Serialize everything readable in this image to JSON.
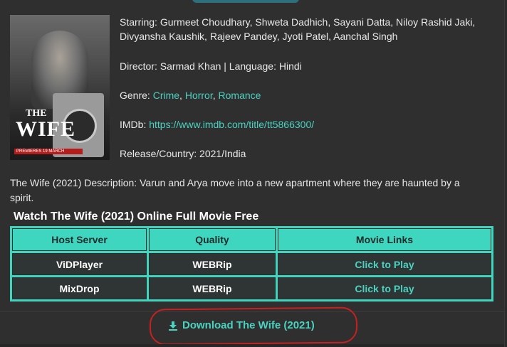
{
  "poster": {
    "title_the": "THE",
    "title_wife": "WIFE",
    "date_text": "PREMIERES 19 MARCH"
  },
  "movie_info": {
    "starring_label": "Starring:",
    "starring_line1": "Gurmeet Choudhary, Shweta Dadhich, Sayani Datta, Niloy Rashid Jaki,",
    "starring_line2": "Divyansha Kaushik, Rajeev Pandey, Jyoti Patel, Aanchal Singh",
    "director_line": "Director: Sarmad Khan | Language: Hindi",
    "genre_label": "Genre:",
    "genres": [
      "Crime",
      "Horror",
      "Romance"
    ],
    "imdb_label": "IMDb:",
    "imdb_url": "https://www.imdb.com/title/tt5866300/",
    "release_line": "Release/Country: 2021/India"
  },
  "description": "The Wife (2021) Description: Varun and Arya move into a new apartment where they are haunted by a spirit.",
  "watch_section": {
    "title": "Watch The Wife (2021) Online Full Movie Free",
    "columns": [
      "Host Server",
      "Quality",
      "Movie Links"
    ],
    "rows": [
      {
        "host": "ViDPlayer",
        "quality": "WEBRip",
        "link": "Click to Play"
      },
      {
        "host": "MixDrop",
        "quality": "WEBRip",
        "link": "Click to Play"
      }
    ]
  },
  "download": {
    "label": "Download The Wife (2021)",
    "icon": "download-icon",
    "highlight_color": "#c82020"
  },
  "colors": {
    "accent": "#49d3c0",
    "table_header": "#3fd6c0",
    "background": "#2f2f2f"
  }
}
